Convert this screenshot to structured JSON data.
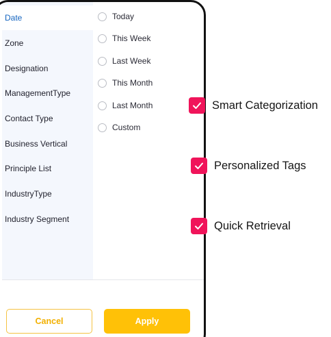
{
  "sidebar": {
    "items": [
      {
        "label": "Date",
        "active": true
      },
      {
        "label": "Zone"
      },
      {
        "label": "Designation"
      },
      {
        "label": "ManagementType"
      },
      {
        "label": "Contact Type"
      },
      {
        "label": "Business Vertical"
      },
      {
        "label": "Principle List"
      },
      {
        "label": "IndustryType"
      },
      {
        "label": "Industry Segment"
      }
    ]
  },
  "options": [
    {
      "label": "Today"
    },
    {
      "label": "This Week"
    },
    {
      "label": "Last Week"
    },
    {
      "label": "This Month"
    },
    {
      "label": "Last Month"
    },
    {
      "label": "Custom"
    }
  ],
  "buttons": {
    "cancel": "Cancel",
    "apply": "Apply"
  },
  "features": [
    {
      "label": "Smart Categorization",
      "icon": "checkmark-icon"
    },
    {
      "label": "Personalized Tags",
      "icon": "checkmark-icon"
    },
    {
      "label": "Quick Retrieval",
      "icon": "checkmark-icon"
    }
  ],
  "colors": {
    "accent_blue": "#1565c0",
    "apply_yellow": "#ffc107",
    "check_pink": "#f0145a",
    "sidebar_bg": "#f4f7fd"
  }
}
